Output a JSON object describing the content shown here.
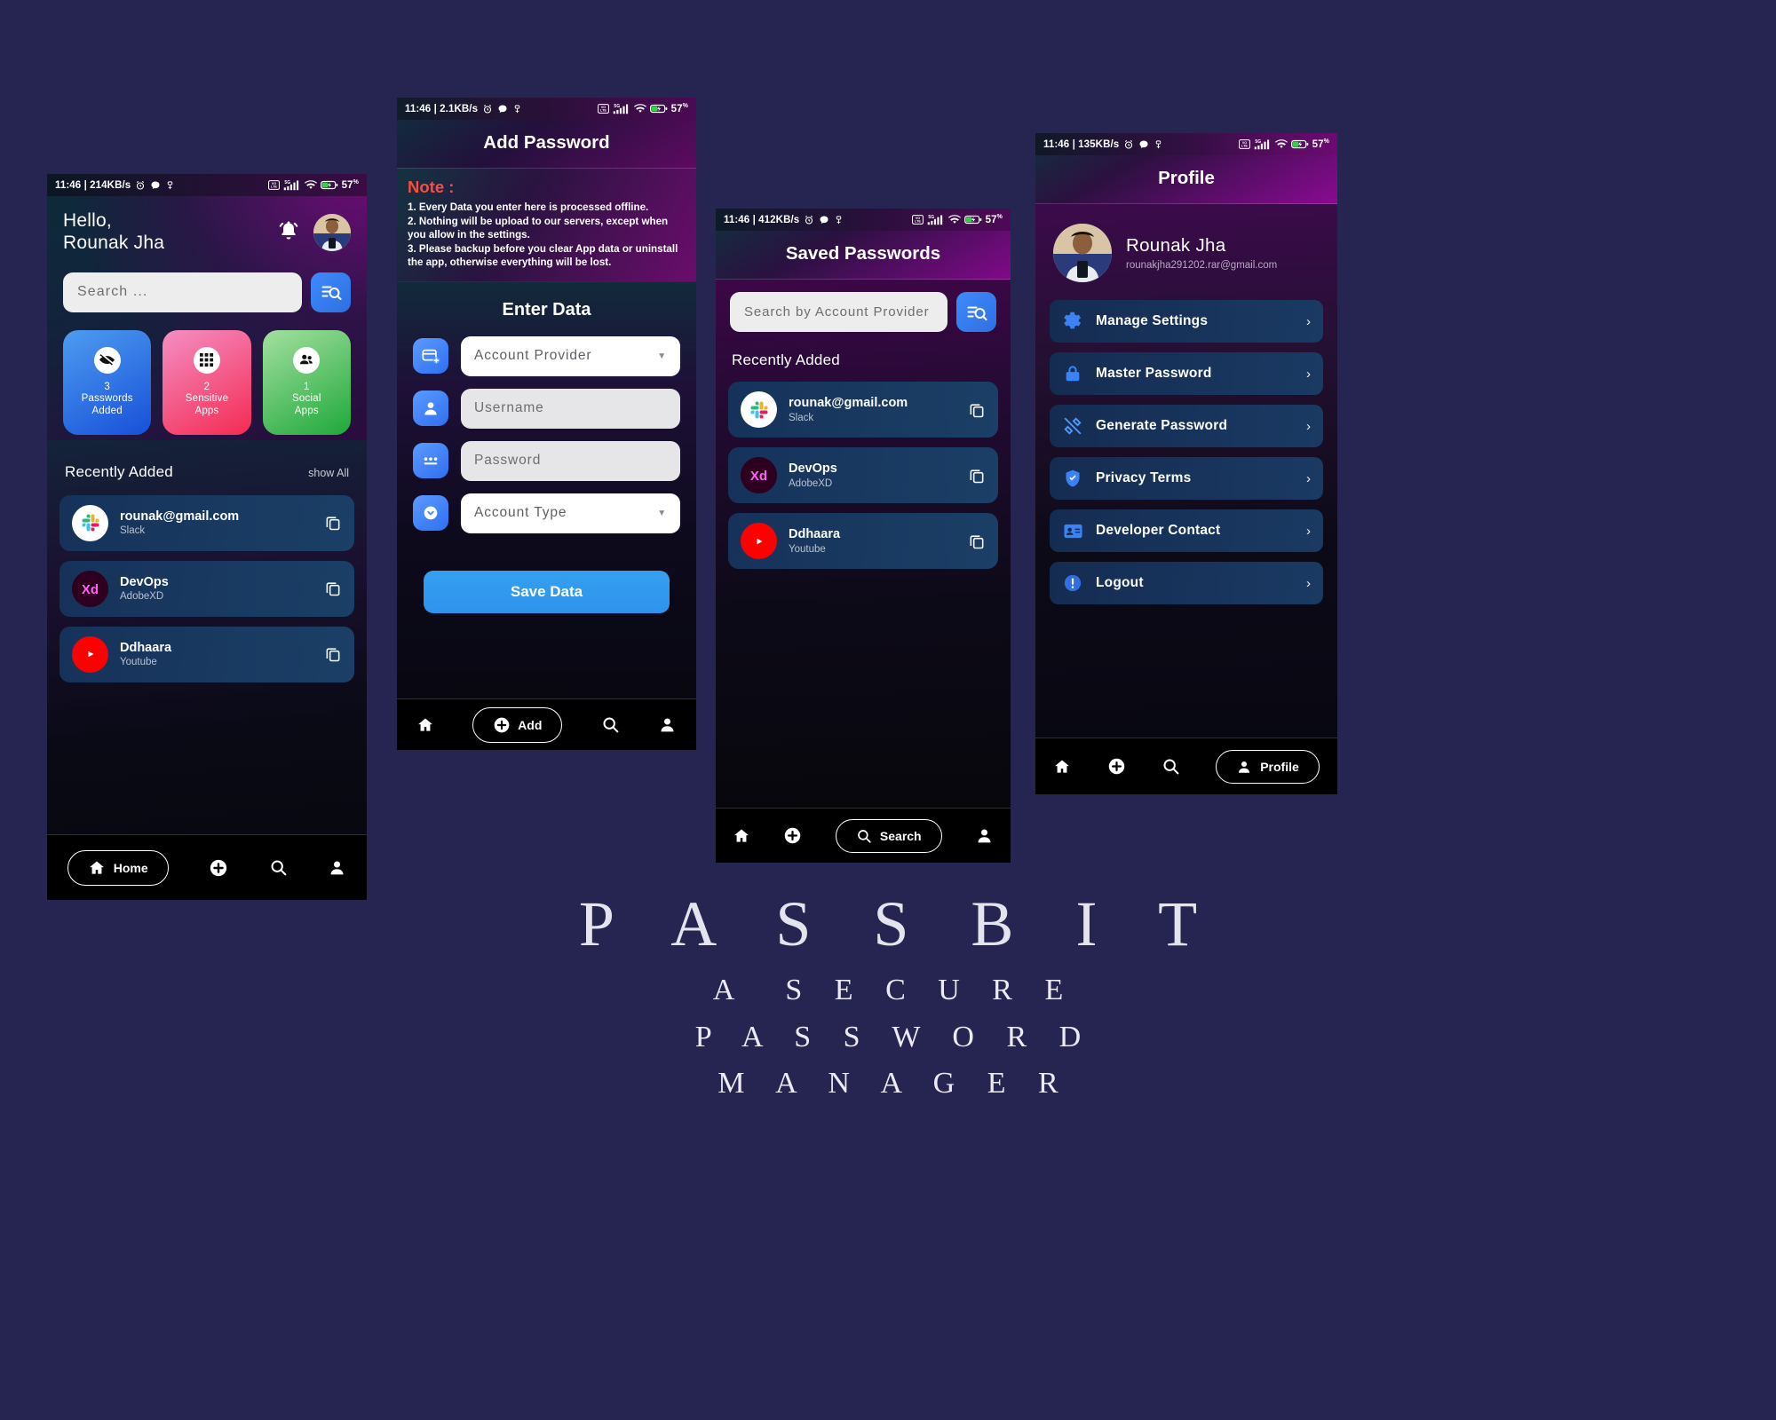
{
  "brand": {
    "name": "P A S S B I T",
    "tagline_lines": [
      "A  S E C U R E",
      "P A S S W O R D",
      "M A N A G E R"
    ]
  },
  "common": {
    "battery": "57",
    "battery_unit": "%",
    "network": "5G",
    "time": "11:46"
  },
  "screens": {
    "home": {
      "status": {
        "time_speed": "11:46 | 214KB/s",
        "battery": "57"
      },
      "greeting_line1": "Hello,",
      "greeting_line2": "Rounak Jha",
      "search_placeholder": "Search ...",
      "stats": [
        {
          "count": "3",
          "label_line1": "Passwords",
          "label_line2": "Added",
          "icon": "eye-off-icon",
          "color": "#1750d8"
        },
        {
          "count": "2",
          "label_line1": "Sensitive",
          "label_line2": "Apps",
          "icon": "apps-grid-icon",
          "color": "#f32b52"
        },
        {
          "count": "1",
          "label_line1": "Social",
          "label_line2": "Apps",
          "icon": "people-icon",
          "color": "#1fa83a"
        }
      ],
      "section_title": "Recently Added",
      "show_all": "show All",
      "accounts": [
        {
          "title": "rounak@gmail.com",
          "subtitle": "Slack",
          "logo": "slack-logo"
        },
        {
          "title": "DevOps",
          "subtitle": "AdobeXD",
          "logo": "adobexd-logo"
        },
        {
          "title": "Ddhaara",
          "subtitle": "Youtube",
          "logo": "youtube-logo"
        }
      ],
      "nav": {
        "active_label": "Home",
        "items": [
          "home-icon",
          "plus-icon",
          "search-icon",
          "person-icon"
        ]
      }
    },
    "add_password": {
      "status": {
        "time_speed": "11:46 | 2.1KB/s",
        "battery": "57"
      },
      "title": "Add Password",
      "note_heading": "Note :",
      "note_lines": [
        "1. Every Data you enter here is processed offline.",
        "2. Nothing will be upload to our servers, except when you allow in the settings.",
        "3. Please backup before you clear App data or uninstall the app, otherwise everything will be lost."
      ],
      "form_title": "Enter Data",
      "fields": [
        {
          "placeholder": "Account Provider",
          "icon": "card-add-icon",
          "dropdown": true,
          "style": "white"
        },
        {
          "placeholder": "Username",
          "icon": "person-icon",
          "dropdown": false,
          "style": "grey"
        },
        {
          "placeholder": "Password",
          "icon": "dots-password-icon",
          "dropdown": false,
          "style": "grey"
        },
        {
          "placeholder": "Account Type",
          "icon": "chevron-circle-icon",
          "dropdown": true,
          "style": "white"
        }
      ],
      "save_label": "Save Data",
      "nav": {
        "active_label": "Add",
        "items": [
          "home-icon",
          "plus-icon",
          "search-icon",
          "person-icon"
        ]
      }
    },
    "saved_passwords": {
      "status": {
        "time_speed": "11:46 | 412KB/s",
        "battery": "57"
      },
      "title": "Saved Passwords",
      "search_placeholder": "Search by Account Provider",
      "section_title": "Recently Added",
      "accounts": [
        {
          "title": "rounak@gmail.com",
          "subtitle": "Slack",
          "logo": "slack-logo"
        },
        {
          "title": "DevOps",
          "subtitle": "AdobeXD",
          "logo": "adobexd-logo"
        },
        {
          "title": "Ddhaara",
          "subtitle": "Youtube",
          "logo": "youtube-logo"
        }
      ],
      "nav": {
        "active_label": "Search",
        "items": [
          "home-icon",
          "plus-icon",
          "search-icon",
          "person-icon"
        ]
      }
    },
    "profile": {
      "status": {
        "time_speed": "11:46 | 135KB/s",
        "battery": "57"
      },
      "title": "Profile",
      "user_name": "Rounak Jha",
      "user_email": "rounakjha291202.rar@gmail.com",
      "menu": [
        {
          "label": "Manage Settings",
          "icon": "gear-icon",
          "color": "#3b82f6"
        },
        {
          "label": "Master Password",
          "icon": "lock-icon",
          "color": "#3b82f6"
        },
        {
          "label": "Generate Password",
          "icon": "tools-icon",
          "color": "#4c9aff"
        },
        {
          "label": "Privacy Terms",
          "icon": "shield-icon",
          "color": "#3b82f6"
        },
        {
          "label": "Developer Contact",
          "icon": "contact-card-icon",
          "color": "#3b82f6"
        },
        {
          "label": "Logout",
          "icon": "alert-icon",
          "color": "#2f6fe0"
        }
      ],
      "nav": {
        "active_label": "Profile",
        "items": [
          "home-icon",
          "plus-icon",
          "search-icon",
          "person-icon"
        ]
      }
    }
  }
}
